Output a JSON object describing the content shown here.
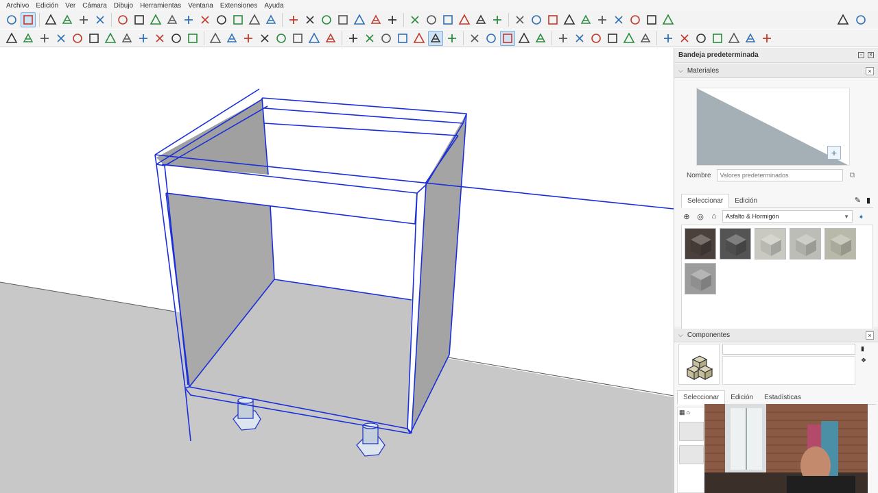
{
  "menu": [
    "Archivo",
    "Edición",
    "Ver",
    "Cámara",
    "Dibujo",
    "Herramientas",
    "Ventana",
    "Extensiones",
    "Ayuda"
  ],
  "toolbar1_icons": [
    "zoom-icon",
    "select-icon",
    "eraser-icon",
    "pencil-icon",
    "arc-icon",
    "rectangle-icon",
    "push-pull-icon",
    "follow-me-icon",
    "move-icon",
    "rotate-icon",
    "scale-icon",
    "offset-icon",
    "paint-bucket-icon",
    "orbit-icon",
    "pan-icon",
    "zoom-window-icon",
    "zoom-extents-icon",
    "section-plane-icon",
    "styles-icon",
    "layers-icon",
    "shadows-icon",
    "fog-icon",
    "warehouse-icon",
    "tape-measure-icon",
    "protractor-icon",
    "dimension-icon",
    "text-icon",
    "axes-icon",
    "3d-text-icon",
    "solid-union-icon",
    "solid-subtract-icon",
    "solid-trim-icon",
    "solid-split-icon",
    "sandbox-icon",
    "flip-icon",
    "camera-icon",
    "walk-icon",
    "position-camera-icon",
    "look-around-icon"
  ],
  "toolbar2_icons": [
    "iso-view-icon",
    "top-view-icon",
    "front-view-icon",
    "right-view-icon",
    "back-view-icon",
    "left-view-icon",
    "xray-icon",
    "wireframe-icon",
    "hidden-line-icon",
    "shaded-icon",
    "textured-icon",
    "monochrome-icon",
    "component-icon",
    "group-icon",
    "outliner-icon",
    "scene-icon",
    "entity-info-icon",
    "sketch-icon",
    "grid-icon",
    "frame-icon",
    "gear-icon",
    "close-icon",
    "drop-icon",
    "drop-filled-icon",
    "drop-blue-icon",
    "drop-active-icon",
    "drop-outline-icon",
    "snap-icon",
    "magnet-icon",
    "magnet-active-icon",
    "plus-circle-icon",
    "line-tool-icon",
    "hexagon-icon",
    "hexagon-fill-icon",
    "hexagon-blue-icon",
    "hexagon-red-icon",
    "axes-red-icon",
    "move-red-icon",
    "terrain-icon",
    "terrain-blue-icon",
    "terrain-grid-icon",
    "dcl-icon",
    "connector-icon",
    "tree-icon",
    "export-icon"
  ],
  "tray": {
    "title": "Bandeja predeterminada",
    "materials": {
      "title": "Materiales",
      "name_label": "Nombre",
      "name_placeholder": "Valores predeterminados",
      "tabs": [
        "Seleccionar",
        "Edición"
      ],
      "library": "Asfalto & Hormigón",
      "swatch_colors": [
        "#4a403c",
        "#545454",
        "#c9c9c2",
        "#bdbdb8",
        "#b9b9aa",
        "#9c9c9c"
      ]
    },
    "components": {
      "title": "Componentes",
      "tabs": [
        "Seleccionar",
        "Edición",
        "Estadísticas"
      ]
    }
  },
  "colors": {
    "accent": "#1f3ecf",
    "selection_edge": "#1a2fd9",
    "ground": "#c9c9c9",
    "panel_inner": "#b8b8b8"
  }
}
